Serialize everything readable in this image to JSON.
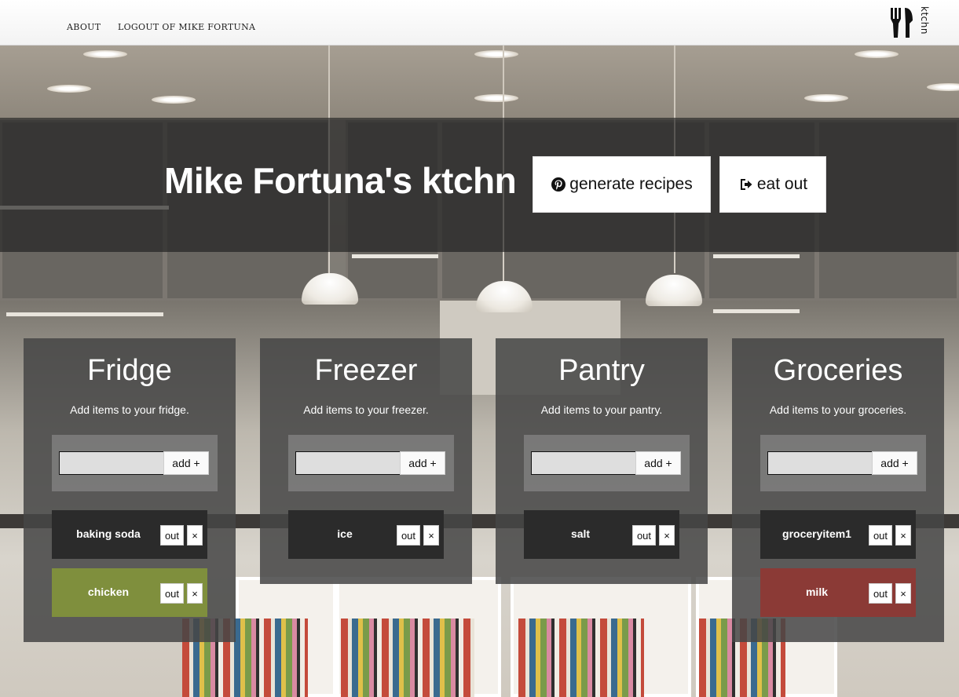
{
  "nav": {
    "about": "ABOUT",
    "logout": "LOGOUT OF MIKE FORTUNA",
    "logo_text": "ktchn",
    "logo_icon": "fork-knife-icon"
  },
  "hero": {
    "title": "Mike Fortuna's ktchn",
    "generate_label": "generate recipes",
    "generate_icon": "pinterest-icon",
    "eatout_label": "eat out",
    "eatout_icon": "sign-out-icon"
  },
  "panels": [
    {
      "title": "Fridge",
      "hint": "Add items to your fridge.",
      "input_value": "",
      "add_label": "add +",
      "items": [
        {
          "name": "baking soda",
          "out_label": "out",
          "remove_label": "×",
          "status": "normal"
        },
        {
          "name": "chicken",
          "out_label": "out",
          "remove_label": "×",
          "status": "fresh"
        }
      ]
    },
    {
      "title": "Freezer",
      "hint": "Add items to your freezer.",
      "input_value": "",
      "add_label": "add +",
      "items": [
        {
          "name": "ice",
          "out_label": "out",
          "remove_label": "×",
          "status": "normal"
        }
      ]
    },
    {
      "title": "Pantry",
      "hint": "Add items to your pantry.",
      "input_value": "",
      "add_label": "add +",
      "items": [
        {
          "name": "salt",
          "out_label": "out",
          "remove_label": "×",
          "status": "normal"
        }
      ]
    },
    {
      "title": "Groceries",
      "hint": "Add items to your groceries.",
      "input_value": "",
      "add_label": "add +",
      "items": [
        {
          "name": "groceryitem1",
          "out_label": "out",
          "remove_label": "×",
          "status": "normal"
        },
        {
          "name": "milk",
          "out_label": "out",
          "remove_label": "×",
          "status": "spoiled"
        }
      ]
    }
  ],
  "colors": {
    "item_normal": "#2b2b2b",
    "item_fresh": "#7f8f3d",
    "item_spoiled": "#8b3a36",
    "panel_bg": "#464646",
    "hero_band": "#2d2d2d"
  }
}
